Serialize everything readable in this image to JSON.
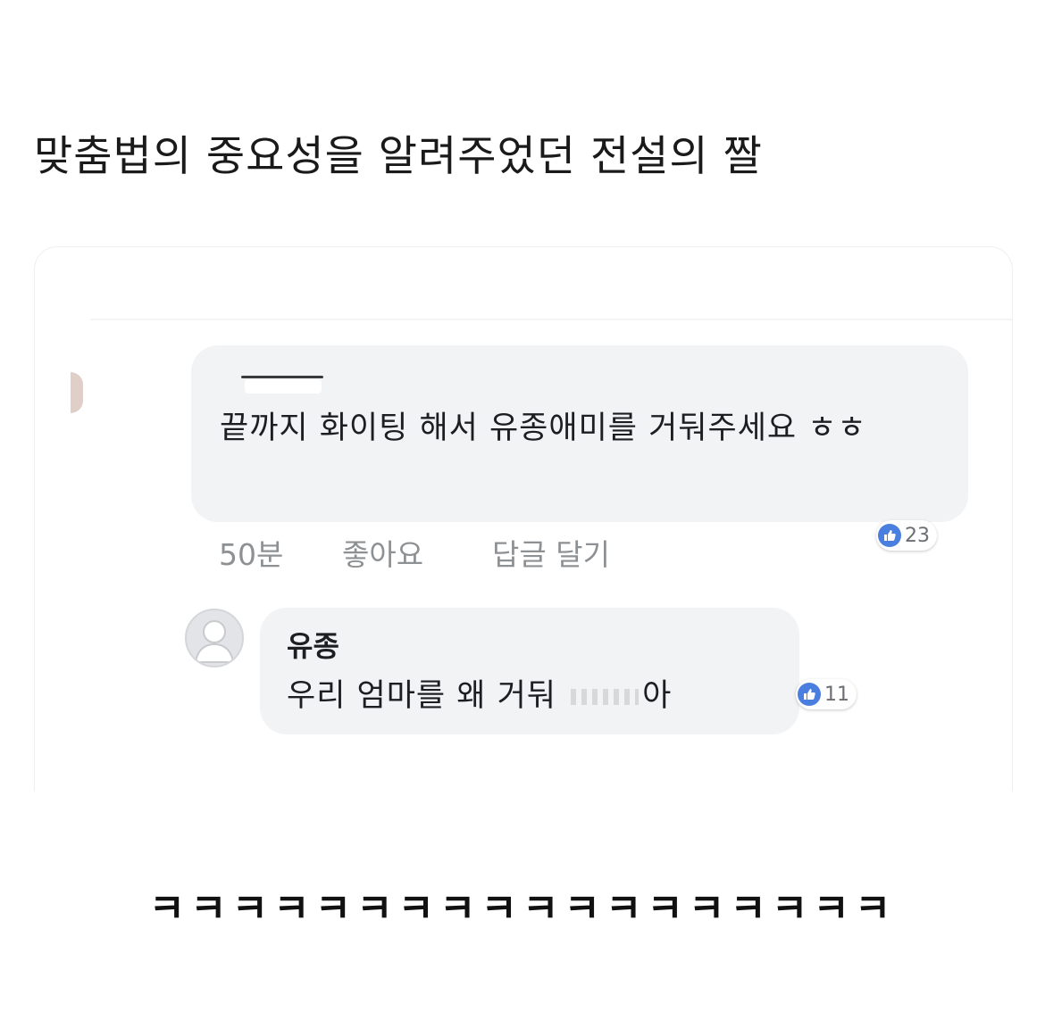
{
  "title": "맞춤법의 중요성을 알려주었던 전설의 짤",
  "comment": {
    "text": "끝까지 화이팅 해서 유종애미를 거둬주세요 ㅎㅎ",
    "time": "50분",
    "like_action": "좋아요",
    "reply_action": "답글 달기",
    "like_count": "23"
  },
  "reply": {
    "author": "유종",
    "text_before": "우리 엄마를 왜 거둬 ",
    "text_after": "아",
    "like_count": "11"
  },
  "footer_laugh": "ㅋㅋㅋㅋㅋㅋㅋㅋㅋㅋㅋㅋㅋㅋㅋㅋㅋㅋ",
  "colors": {
    "bubble": "#f2f3f5",
    "meta_text": "#8e9194",
    "like_blue": "#4a7fe0"
  }
}
